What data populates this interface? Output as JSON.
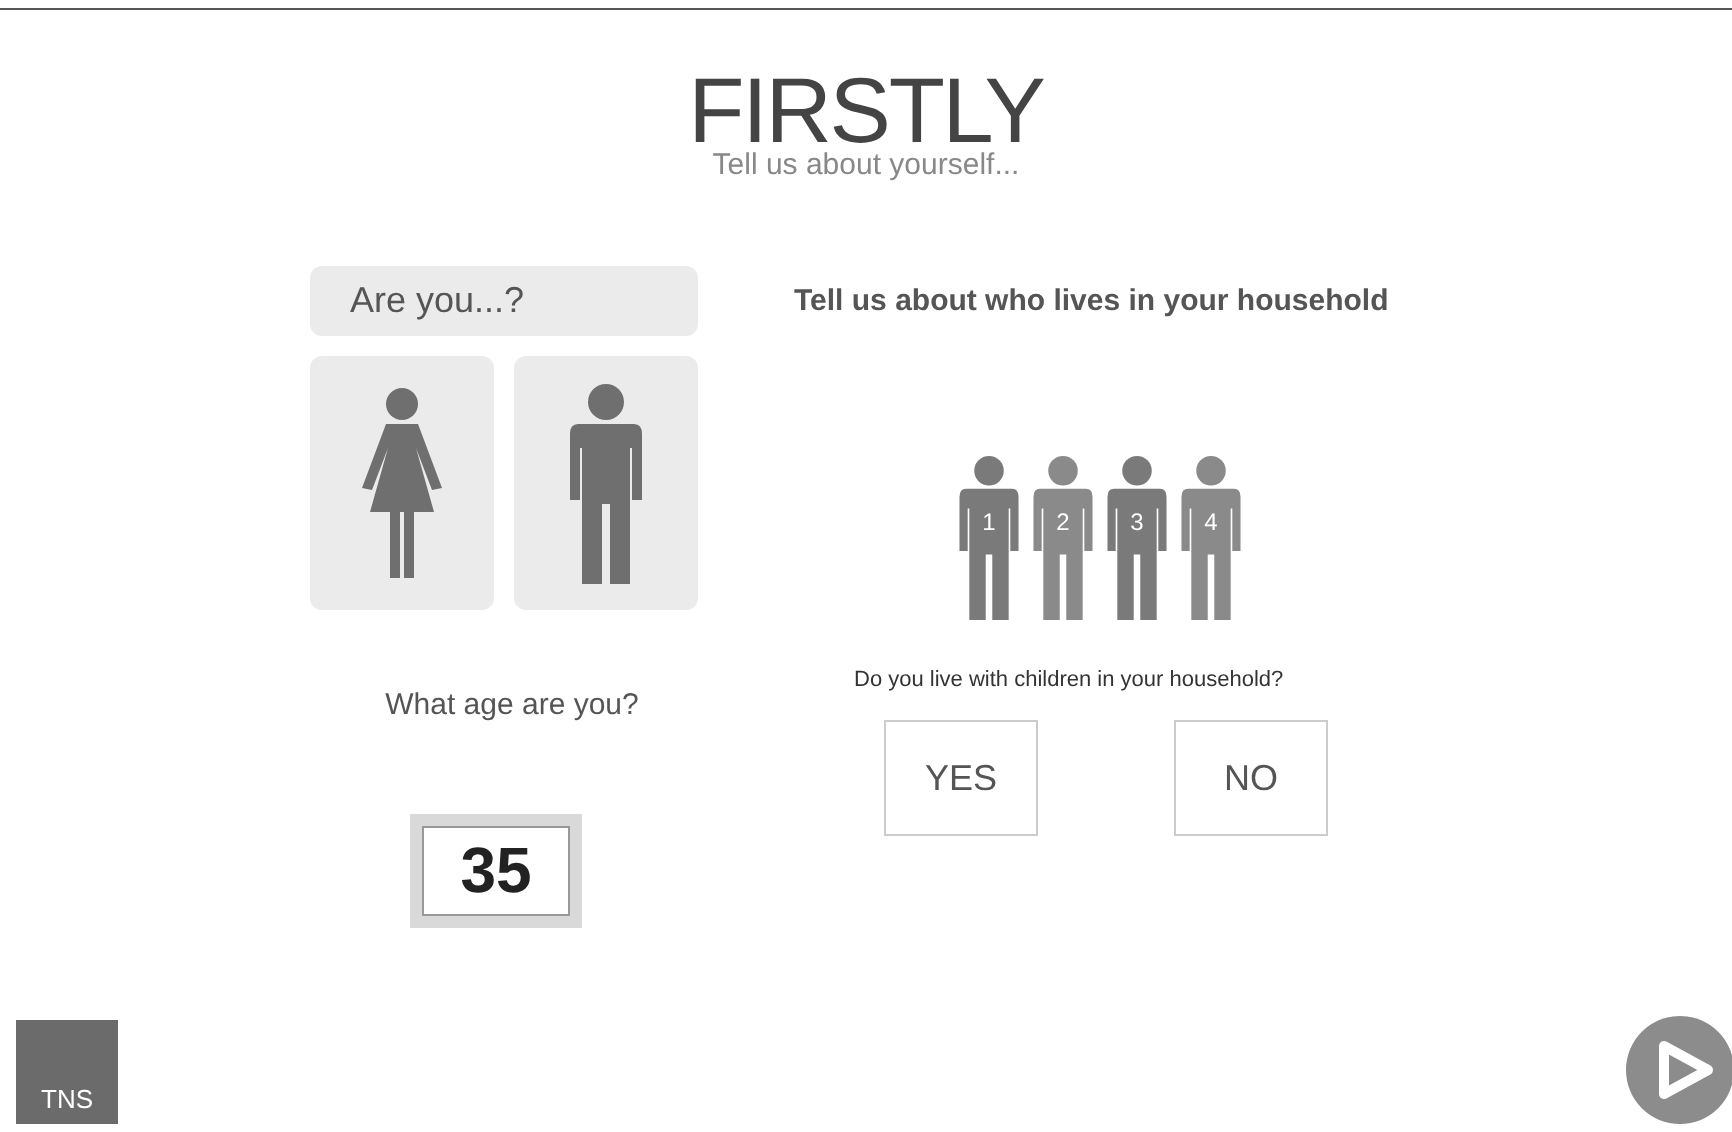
{
  "header": {
    "title": "FIRSTLY",
    "subtitle": "Tell us about yourself..."
  },
  "gender": {
    "question": "Are you...?",
    "options": [
      {
        "kind": "female",
        "selected": false
      },
      {
        "kind": "male",
        "selected": false
      }
    ]
  },
  "age": {
    "question": "What age are you?",
    "value": "35"
  },
  "household": {
    "question": "Tell us about who lives in your household",
    "members": [
      "1",
      "2",
      "3",
      "4"
    ]
  },
  "children": {
    "question": "Do you live with children in your household?",
    "buttons": [
      "YES",
      "NO"
    ]
  },
  "logo": "TNS"
}
